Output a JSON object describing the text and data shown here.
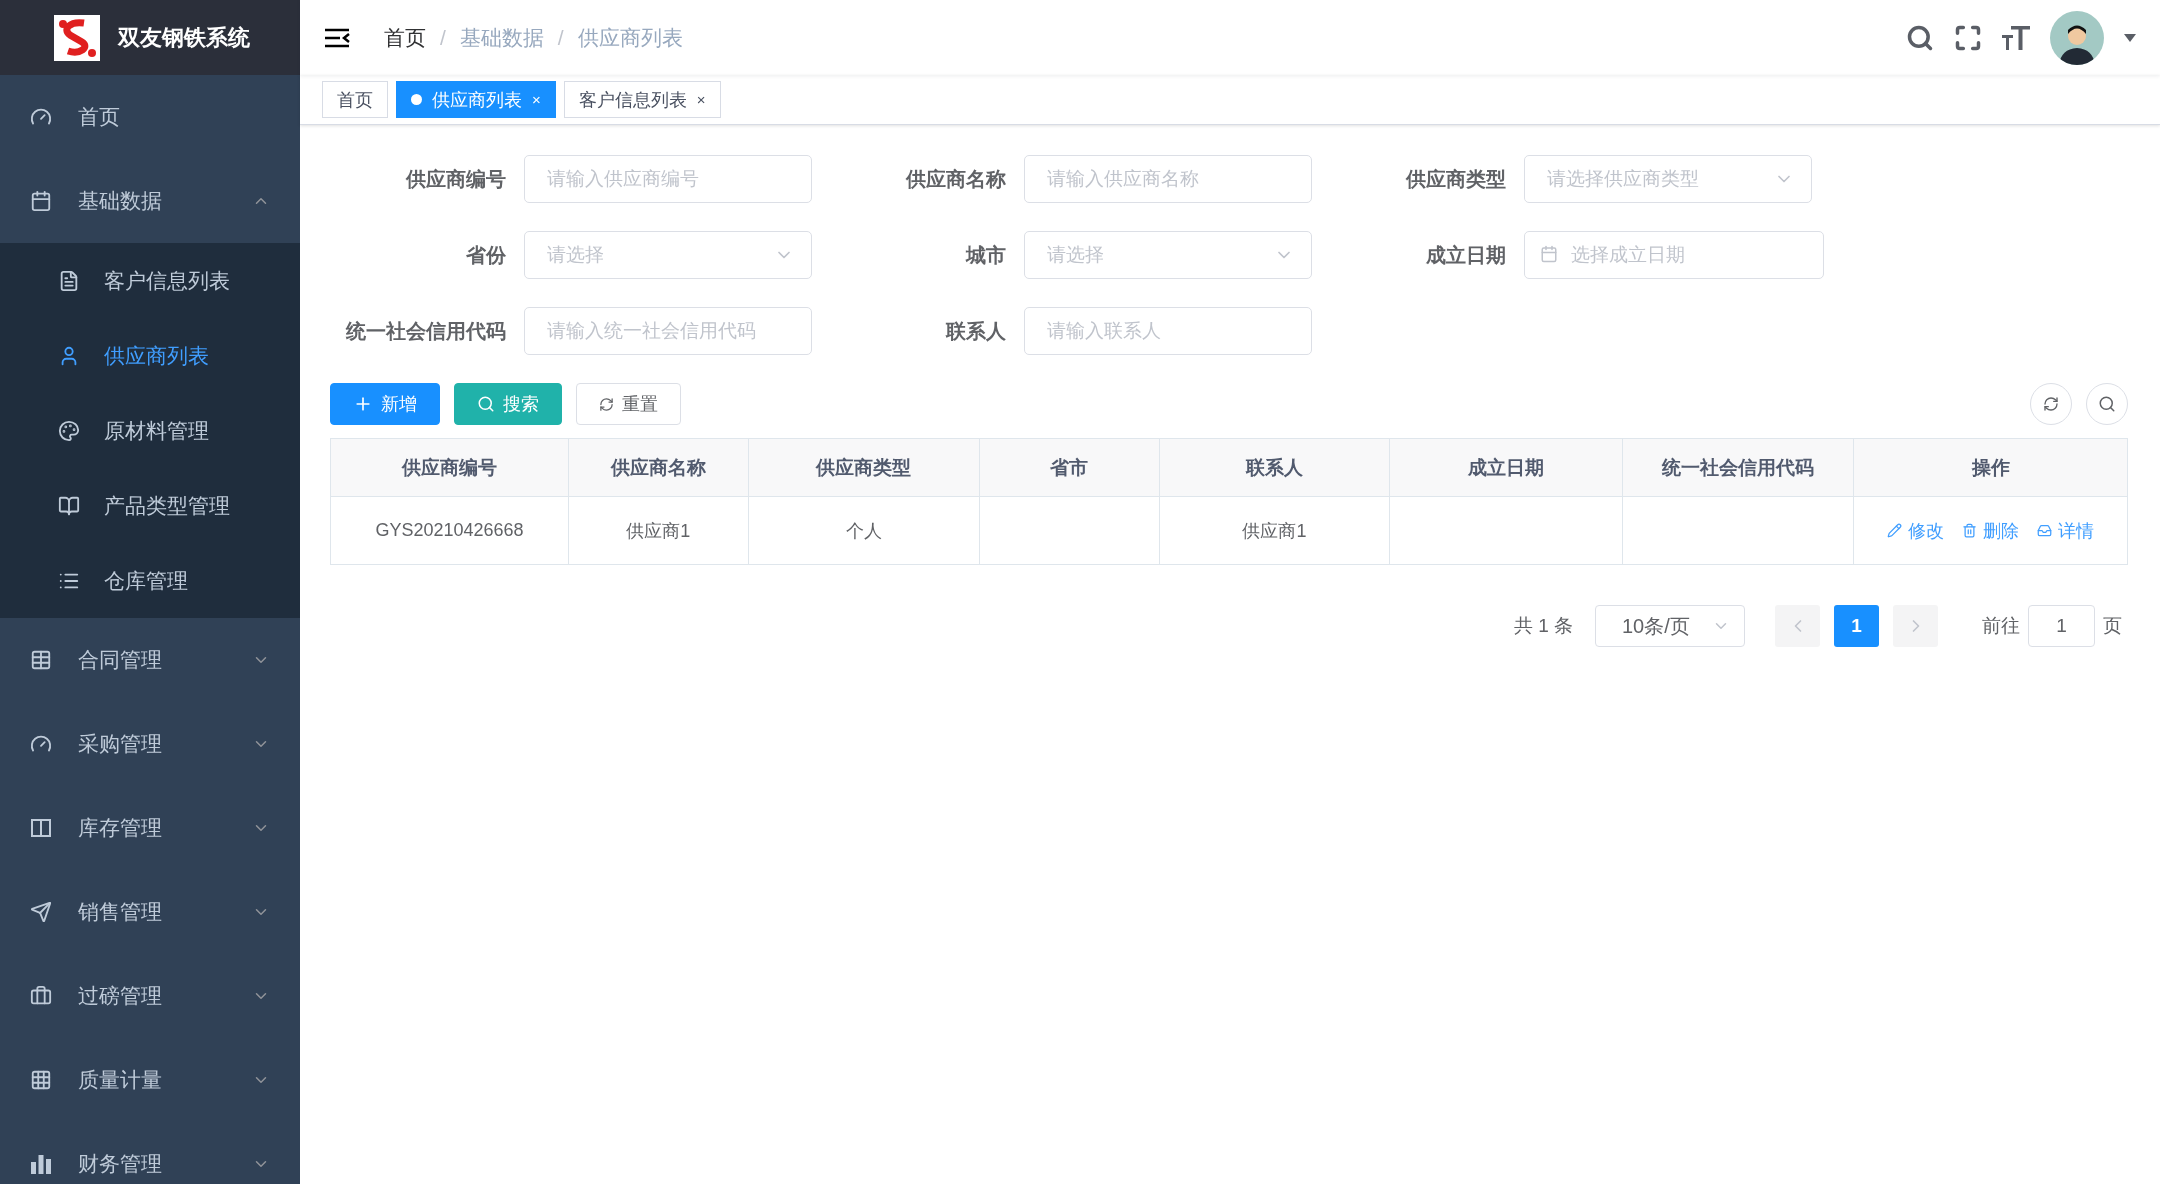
{
  "app": {
    "title": "双友钢铁系统"
  },
  "sidebar": {
    "items": [
      {
        "label": "首页",
        "selected": false
      },
      {
        "label": "基础数据",
        "expanded": true,
        "selected": false,
        "children": [
          {
            "label": "客户信息列表",
            "selected": false
          },
          {
            "label": "供应商列表",
            "selected": true
          },
          {
            "label": "原材料管理",
            "selected": false
          },
          {
            "label": "产品类型管理",
            "selected": false
          },
          {
            "label": "仓库管理",
            "selected": false
          }
        ]
      },
      {
        "label": "合同管理",
        "expanded": false,
        "selected": false
      },
      {
        "label": "采购管理",
        "expanded": false,
        "selected": false
      },
      {
        "label": "库存管理",
        "expanded": false,
        "selected": false
      },
      {
        "label": "销售管理",
        "expanded": false,
        "selected": false
      },
      {
        "label": "过磅管理",
        "expanded": false,
        "selected": false
      },
      {
        "label": "质量计量",
        "expanded": false,
        "selected": false
      },
      {
        "label": "财务管理",
        "expanded": false,
        "selected": false
      }
    ]
  },
  "breadcrumb": [
    {
      "label": "首页",
      "current": false
    },
    {
      "separator": "/",
      "label": "基础数据",
      "current": true
    },
    {
      "separator": "/",
      "label": "供应商列表",
      "current": true
    }
  ],
  "tags": [
    {
      "label": "首页",
      "selected": false
    },
    {
      "label": "供应商列表",
      "selected": true,
      "close": "×"
    },
    {
      "label": "客户信息列表",
      "selected": false,
      "close": "×"
    }
  ],
  "filters": [
    {
      "label": "供应商编号",
      "kind": "text",
      "placeholder": "请输入供应商编号"
    },
    {
      "label": "供应商名称",
      "kind": "text",
      "placeholder": "请输入供应商名称"
    },
    {
      "label": "供应商类型",
      "kind": "select",
      "placeholder": "请选择供应商类型"
    },
    {
      "label": "省份",
      "kind": "select",
      "placeholder": "请选择"
    },
    {
      "label": "城市",
      "kind": "select",
      "placeholder": "请选择"
    },
    {
      "label": "成立日期",
      "kind": "date",
      "placeholder": "选择成立日期"
    },
    {
      "label": "统一社会信用代码",
      "kind": "text",
      "placeholder": "请输入统一社会信用代码"
    },
    {
      "label": "联系人",
      "kind": "text",
      "placeholder": "请输入联系人"
    }
  ],
  "buttons": [
    {
      "label": "新增",
      "kind": "primary"
    },
    {
      "label": "搜索",
      "kind": "success"
    },
    {
      "label": "重置",
      "kind": "plain"
    }
  ],
  "table": {
    "columns": [
      "供应商编号",
      "供应商名称",
      "供应商类型",
      "省市",
      "联系人",
      "成立日期",
      "统一社会信用代码",
      "操作"
    ],
    "rows": [
      {
        "cells": [
          "GYS20210426668",
          "供应商1",
          "个人",
          null,
          "供应商1",
          null,
          null
        ],
        "actions": [
          {
            "label": "修改",
            "kind": "edit"
          },
          {
            "label": "删除",
            "kind": "delete"
          },
          {
            "label": "详情",
            "kind": "detail"
          }
        ]
      }
    ]
  },
  "pagination": {
    "total": "共 1 条",
    "page_size": "10条/页",
    "pages": [
      {
        "label": "1",
        "selected": true
      }
    ],
    "goto_label": "前往",
    "goto_value": "1",
    "page_suffix": "页"
  }
}
